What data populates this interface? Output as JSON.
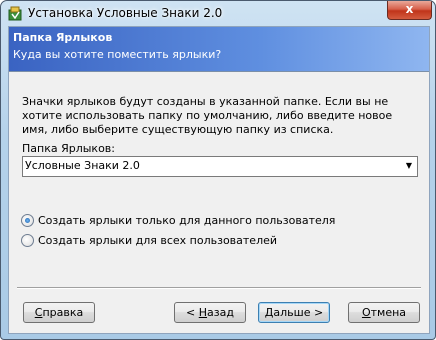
{
  "window": {
    "title": "Установка Условные Знаки 2.0",
    "close_glyph": "x"
  },
  "header": {
    "title": "Папка Ярлыков",
    "subtitle": "Куда вы хотите поместить ярлыки?"
  },
  "description": "Значки ярлыков будут созданы в указанной папке. Если вы не хотите использовать папку по умолчанию, либо введите новое имя, либо выберите существующую папку из списка.",
  "folder": {
    "label": "Папка Ярлыков:",
    "value": "Условные Знаки 2.0"
  },
  "options": [
    {
      "label": "Создать ярлыки только для данного пользователя",
      "checked": true
    },
    {
      "label": "Создать ярлыки для всех пользователей",
      "checked": false
    }
  ],
  "buttons": {
    "help": {
      "pre": "",
      "key": "С",
      "post": "правка"
    },
    "back": {
      "pre": "< ",
      "key": "Н",
      "post": "азад"
    },
    "next": {
      "pre": "",
      "key": "Д",
      "post": "альше >"
    },
    "cancel": {
      "pre": "",
      "key": "О",
      "post": "тмена"
    }
  }
}
